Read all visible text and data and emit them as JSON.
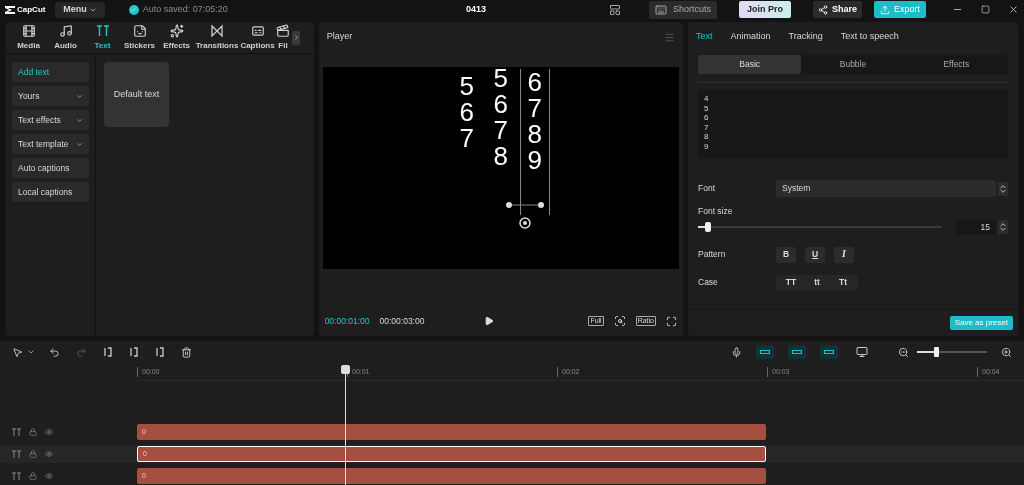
{
  "titlebar": {
    "app_name": "CapCut",
    "menu": "Menu",
    "autosave": "Auto saved: 07:05:20",
    "project": "0413",
    "shortcuts": "Shortcuts",
    "join_pro": "Join Pro",
    "share": "Share",
    "export": "Export"
  },
  "media_tabs": [
    {
      "label": "Media",
      "selected": false
    },
    {
      "label": "Audio",
      "selected": false
    },
    {
      "label": "Text",
      "selected": true
    },
    {
      "label": "Stickers",
      "selected": false
    },
    {
      "label": "Effects",
      "selected": false
    },
    {
      "label": "Transitions",
      "selected": false
    },
    {
      "label": "Captions",
      "selected": false
    },
    {
      "label": "Fil",
      "selected": false
    }
  ],
  "sidebar": [
    {
      "label": "Add text",
      "selected": true,
      "dropdown": false
    },
    {
      "label": "Yours",
      "selected": false,
      "dropdown": true
    },
    {
      "label": "Text effects",
      "selected": false,
      "dropdown": true
    },
    {
      "label": "Text template",
      "selected": false,
      "dropdown": true
    },
    {
      "label": "Auto captions",
      "selected": false,
      "dropdown": false
    },
    {
      "label": "Local captions",
      "selected": false,
      "dropdown": false
    }
  ],
  "presets": [
    "Default text"
  ],
  "player": {
    "title": "Player",
    "columns": [
      [
        "5",
        "6",
        "7"
      ],
      [
        "5",
        "6",
        "7",
        "8"
      ],
      [
        "6",
        "7",
        "8",
        "9"
      ]
    ],
    "current_time": "00:00:01:00",
    "duration": "00:00:03:00",
    "full": "Full",
    "ratio": "Ratio"
  },
  "inspector": {
    "tabs": [
      {
        "label": "Text",
        "selected": true
      },
      {
        "label": "Animation",
        "selected": false
      },
      {
        "label": "Tracking",
        "selected": false
      },
      {
        "label": "Text to speech",
        "selected": false
      }
    ],
    "subtabs": [
      {
        "label": "Basic",
        "selected": true
      },
      {
        "label": "Bubble",
        "selected": false
      },
      {
        "label": "Effects",
        "selected": false
      }
    ],
    "text_lines": [
      "4",
      "5",
      "6",
      "7",
      "8",
      "9"
    ],
    "font_label": "Font",
    "font": "System",
    "font_size_label": "Font size",
    "font_size": {
      "level": 0.04,
      "value": "15"
    },
    "pattern_label": "Pattern",
    "pattern": [
      "B",
      "U",
      "I"
    ],
    "case_label": "Case",
    "case": [
      "TT",
      "tt",
      "Tt"
    ],
    "save_preset": "Save as preset"
  },
  "timeline": {
    "zoom": {
      "level": 0.27
    },
    "ruler": [
      "00:00",
      "00:01",
      "00:02",
      "00:03",
      "00:04"
    ],
    "tracks": [
      {
        "clip": "0",
        "selected": false
      },
      {
        "clip": "0",
        "selected": true
      },
      {
        "clip": "0",
        "selected": false
      }
    ]
  }
}
